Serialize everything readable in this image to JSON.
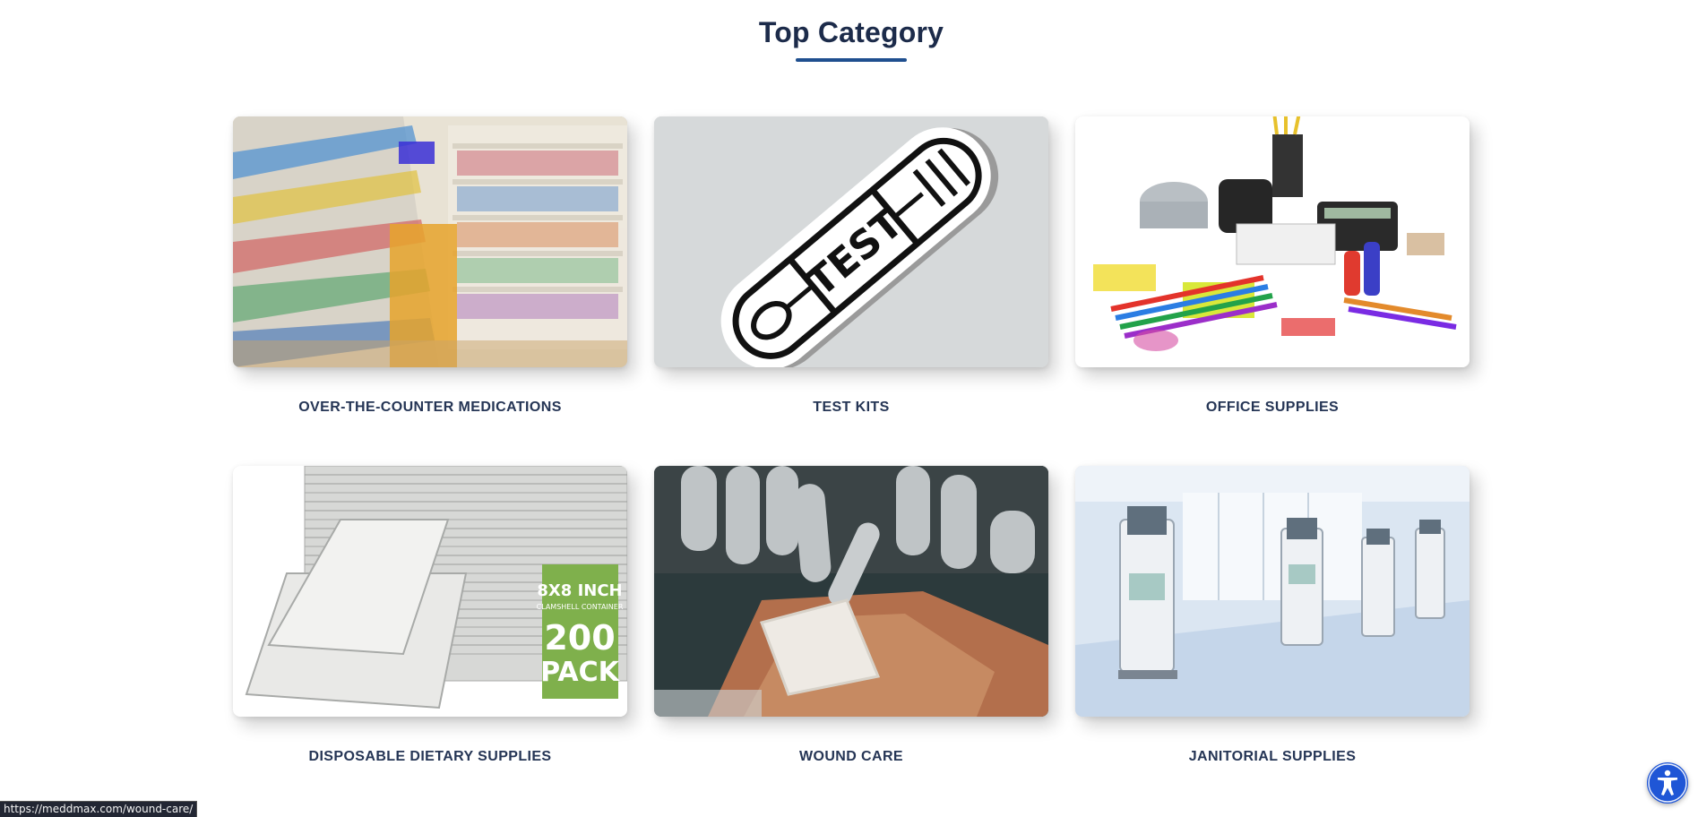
{
  "section": {
    "title": "Top Category"
  },
  "categories": [
    {
      "label": "OVER-THE-COUNTER MEDICATIONS",
      "image": "pharmacy-shelves-image"
    },
    {
      "label": "TEST KITS",
      "image": "test-tube-image"
    },
    {
      "label": "OFFICE SUPPLIES",
      "image": "office-supplies-image"
    },
    {
      "label": "DISPOSABLE DIETARY SUPPLIES",
      "image": "clamshell-containers-image"
    },
    {
      "label": "WOUND CARE",
      "image": "bandaged-hand-image"
    },
    {
      "label": "JANITORIAL SUPPLIES",
      "image": "dialysis-room-image"
    }
  ],
  "test_kit_image_text": "TEST",
  "container_pack_text": {
    "size": "8X8 INCH",
    "sub": "CLAMSHELL CONTAINER",
    "count": "200",
    "pack": "PACK"
  },
  "status_bar": {
    "url": "https://meddmax.com/wound-care/"
  },
  "accessibility": {
    "icon": "accessibility-icon"
  },
  "colors": {
    "title": "#1c2b4a",
    "underline": "#1f4f8f",
    "label": "#253555",
    "a11y": "#1f56d6"
  }
}
